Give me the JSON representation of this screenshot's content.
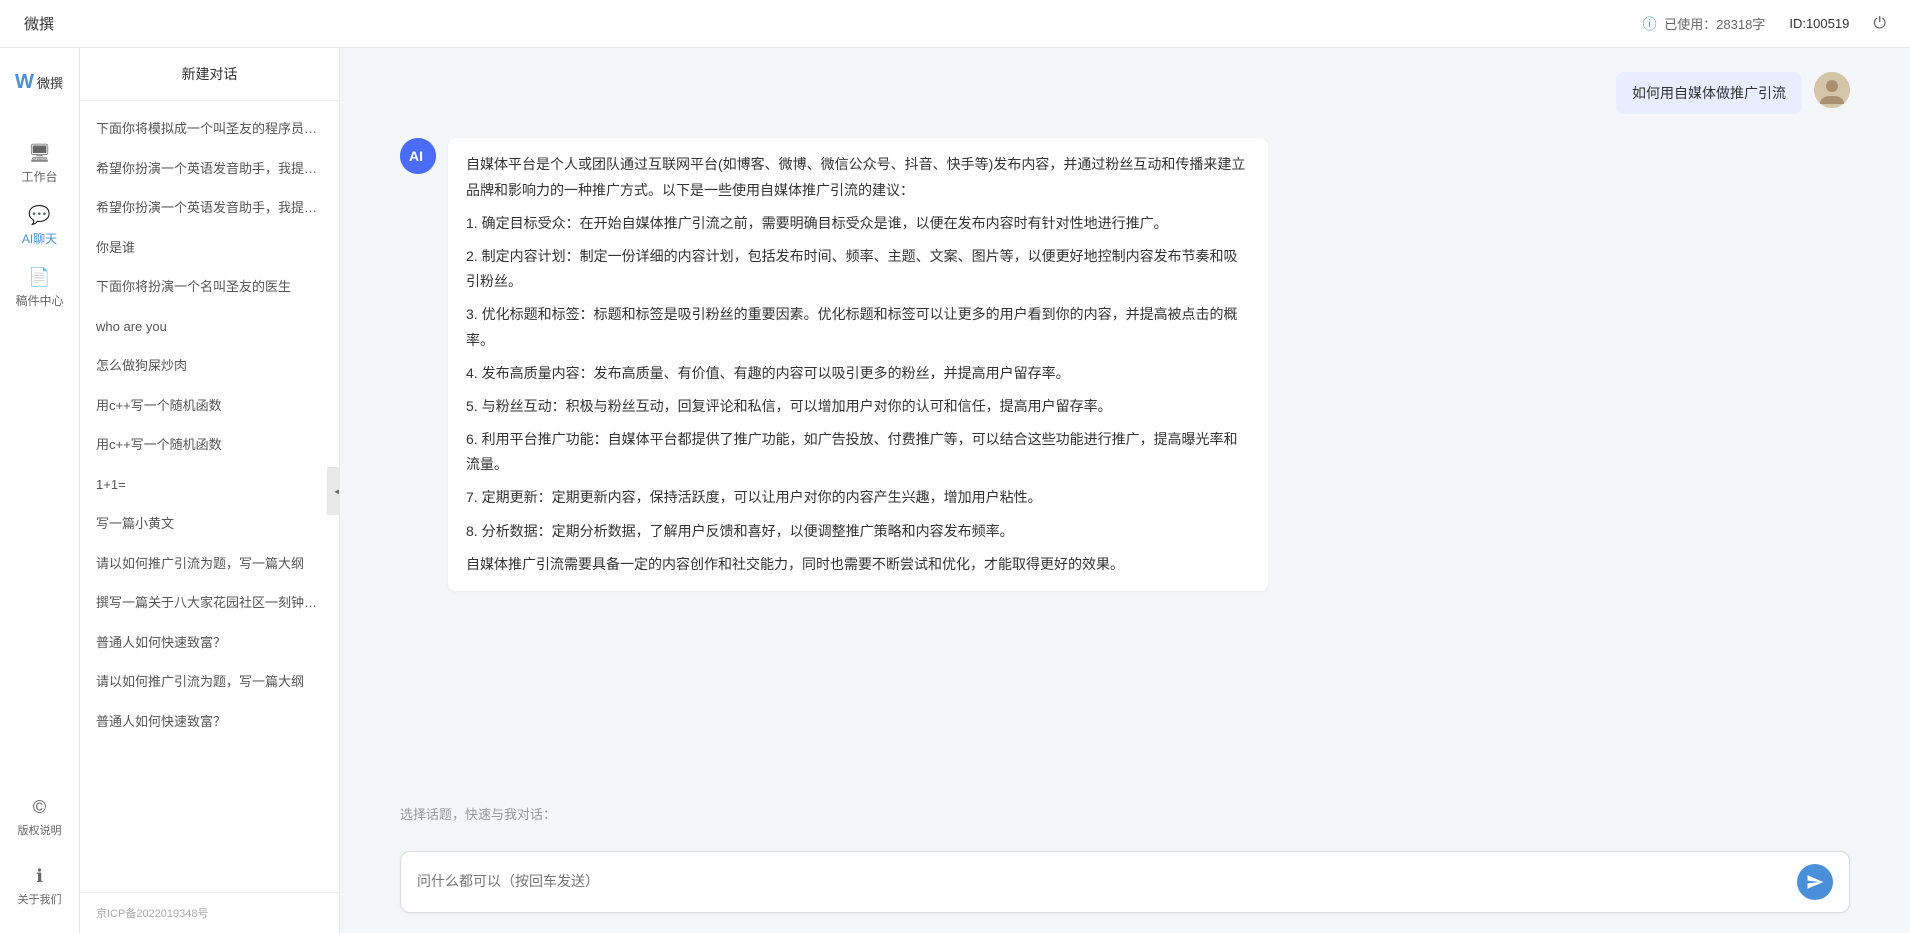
{
  "topbar": {
    "title": "微撰",
    "usage_label": "已使用：28318字",
    "id_label": "ID:100519"
  },
  "nav": {
    "logo_text": "W 微撰",
    "items": [
      {
        "id": "workbench",
        "label": "工作台",
        "icon": "🖥"
      },
      {
        "id": "ai-chat",
        "label": "AI聊天",
        "icon": "💬"
      },
      {
        "id": "components",
        "label": "稿件中心",
        "icon": "📄"
      }
    ],
    "bottom_items": [
      {
        "id": "copyright",
        "label": "版权说明",
        "icon": "©"
      },
      {
        "id": "about",
        "label": "关于我们",
        "icon": "ℹ"
      }
    ]
  },
  "sidebar": {
    "new_chat": "新建对话",
    "items": [
      "下面你将模拟成一个叫圣友的程序员、我说...",
      "希望你扮演一个英语发音助手，我提供给你...",
      "希望你扮演一个英语发音助手，我提供给你...",
      "你是谁",
      "下面你将扮演一个名叫圣友的医生",
      "who are you",
      "怎么做狗屎炒肉",
      "用c++写一个随机函数",
      "用c++写一个随机函数",
      "1+1=",
      "写一篇小黄文",
      "请以如何推广引流为题，写一篇大纲",
      "撰写一篇关于八大家花园社区一刻钟便民生...",
      "普通人如何快速致富？",
      "请以如何推广引流为题，写一篇大纲",
      "普通人如何快速致富？"
    ],
    "icp": "京ICP备2022019348号"
  },
  "chat": {
    "user_message": "如何用自媒体做推广引流",
    "ai_response": {
      "paragraphs": [
        "自媒体平台是个人或团队通过互联网平台(如博客、微博、微信公众号、抖音、快手等)发布内容，并通过粉丝互动和传播来建立品牌和影响力的一种推广方式。以下是一些使用自媒体推广引流的建议：",
        "1. 确定目标受众：在开始自媒体推广引流之前，需要明确目标受众是谁，以便在发布内容时有针对性地进行推广。",
        "2. 制定内容计划：制定一份详细的内容计划，包括发布时间、频率、主题、文案、图片等，以便更好地控制内容发布节奏和吸引粉丝。",
        "3. 优化标题和标签：标题和标签是吸引粉丝的重要因素。优化标题和标签可以让更多的用户看到你的内容，并提高被点击的概率。",
        "4. 发布高质量内容：发布高质量、有价值、有趣的内容可以吸引更多的粉丝，并提高用户留存率。",
        "5. 与粉丝互动：积极与粉丝互动，回复评论和私信，可以增加用户对你的认可和信任，提高用户留存率。",
        "6. 利用平台推广功能：自媒体平台都提供了推广功能，如广告投放、付费推广等，可以结合这些功能进行推广，提高曝光率和流量。",
        "7. 定期更新：定期更新内容，保持活跃度，可以让用户对你的内容产生兴趣，增加用户粘性。",
        "8. 分析数据：定期分析数据，了解用户反馈和喜好，以便调整推广策略和内容发布频率。",
        "自媒体推广引流需要具备一定的内容创作和社交能力，同时也需要不断尝试和优化，才能取得更好的效果。"
      ]
    },
    "prompt_label": "选择话题，快速与我对话：",
    "input_placeholder": "问什么都可以（按回车发送）"
  }
}
